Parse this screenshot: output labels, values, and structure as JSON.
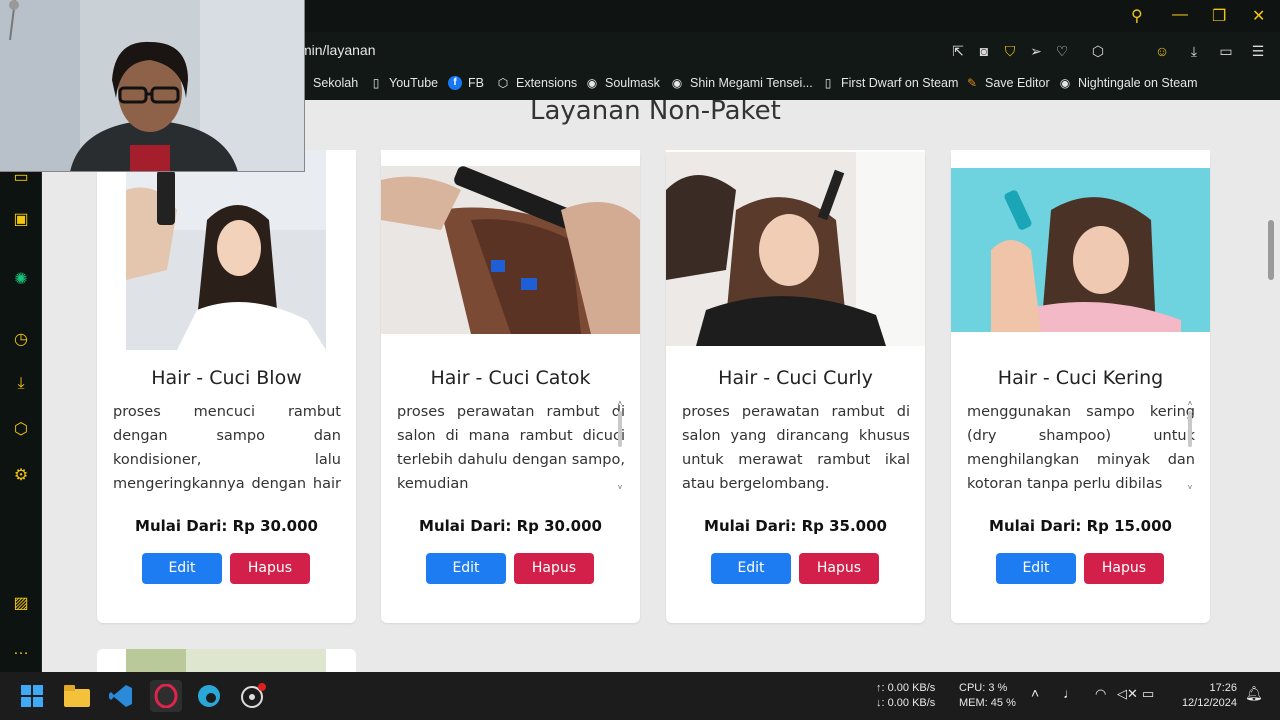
{
  "browser": {
    "url_fragment": "min/layanan",
    "bookmarks": [
      {
        "label": "Sekolah",
        "icon": "folder-icon"
      },
      {
        "label": "YouTube",
        "icon": "page-icon"
      },
      {
        "label": "FB",
        "icon": "facebook-icon"
      },
      {
        "label": "Extensions",
        "icon": "cube-icon"
      },
      {
        "label": "Soulmask",
        "icon": "steam-icon"
      },
      {
        "label": "Shin Megami Tensei...",
        "icon": "steam-icon"
      },
      {
        "label": "First Dwarf on Steam",
        "icon": "page-icon"
      },
      {
        "label": "Save Editor",
        "icon": "edit-icon"
      },
      {
        "label": "Nightingale on Steam",
        "icon": "steam-icon"
      }
    ]
  },
  "page": {
    "heading": "Layanan Non-Paket",
    "cards": [
      {
        "title": "Hair - Cuci Blow",
        "desc": "proses mencuci rambut dengan sampo dan kondisioner, lalu mengeringkannya dengan hair dryer.",
        "price": "Mulai Dari: Rp 30.000",
        "edit": "Edit",
        "delete": "Hapus"
      },
      {
        "title": "Hair - Cuci Catok",
        "desc": "proses perawatan rambut di salon di mana rambut dicuci terlebih dahulu dengan sampo, kemudian",
        "price": "Mulai Dari: Rp 30.000",
        "edit": "Edit",
        "delete": "Hapus"
      },
      {
        "title": "Hair - Cuci Curly",
        "desc": "proses perawatan rambut di salon yang dirancang khusus untuk merawat rambut ikal atau bergelombang.",
        "price": "Mulai Dari: Rp 35.000",
        "edit": "Edit",
        "delete": "Hapus"
      },
      {
        "title": "Hair - Cuci Kering",
        "desc": "menggunakan sampo kering (dry shampoo) untuk menghilangkan minyak dan kotoran tanpa perlu dibilas",
        "price": "Mulai Dari: Rp 15.000",
        "edit": "Edit",
        "delete": "Hapus"
      }
    ]
  },
  "taskbar": {
    "net_up": "↑: 0.00 KB/s",
    "net_down": "↓: 0.00 KB/s",
    "cpu": "CPU: 3 %",
    "mem": "MEM: 45 %",
    "time": "17:26",
    "date": "12/12/2024"
  },
  "colors": {
    "edit_button": "#1e7cf2",
    "delete_button": "#d3204a",
    "accent": "#f1c40f"
  }
}
